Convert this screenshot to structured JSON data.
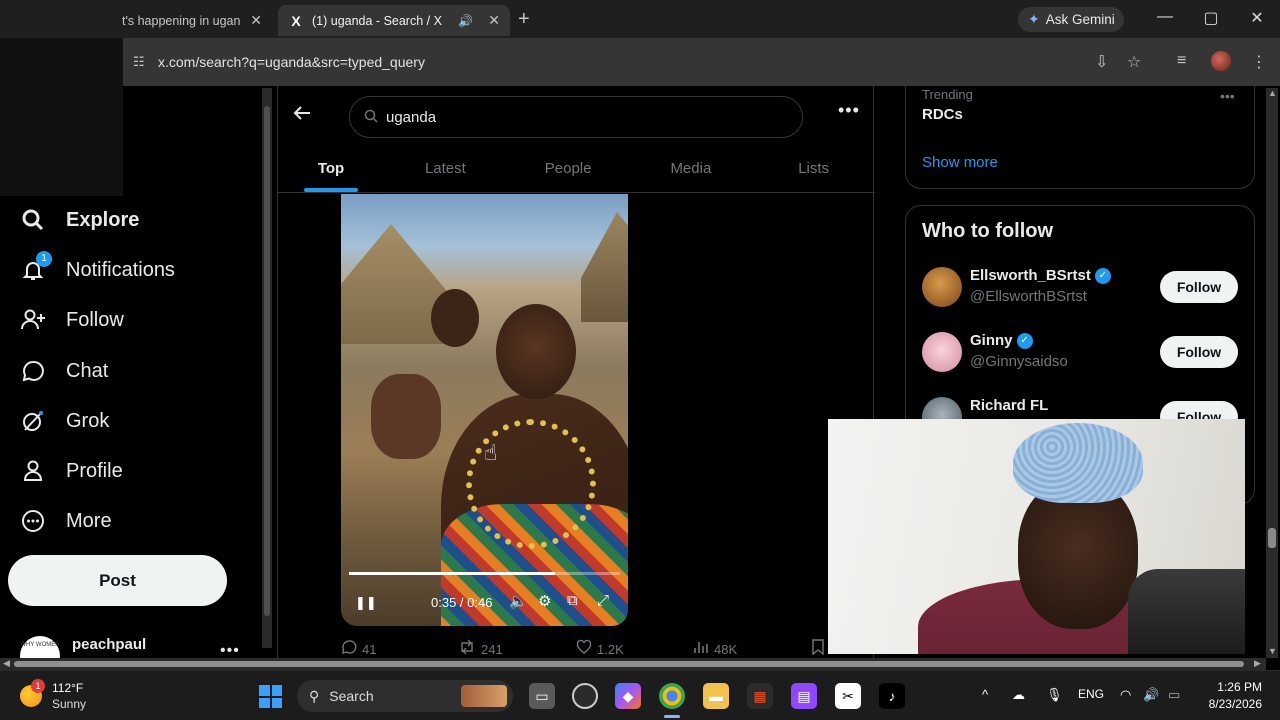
{
  "browser": {
    "tabs": [
      {
        "title": "t's happening in ugan",
        "close": "✕"
      },
      {
        "title": "(1) uganda - Search / X",
        "favicon": "X",
        "close": "✕",
        "speaker": "🔊"
      }
    ],
    "new_tab": "+",
    "gemini_label": "Ask Gemini",
    "window_controls": {
      "minimize": "—",
      "maximize": "▢",
      "close": "✕"
    },
    "url": "x.com/search?q=uganda&src=typed_query"
  },
  "sidebar": {
    "items": [
      {
        "label": "Explore",
        "icon": "search-icon",
        "bold": true
      },
      {
        "label": "Notifications",
        "icon": "bell-icon",
        "badge": "1"
      },
      {
        "label": "Follow",
        "icon": "follow-icon"
      },
      {
        "label": "Chat",
        "icon": "chat-icon"
      },
      {
        "label": "Grok",
        "icon": "grok-icon"
      },
      {
        "label": "Profile",
        "icon": "profile-icon"
      },
      {
        "label": "More",
        "icon": "more-icon"
      }
    ],
    "post_label": "Post",
    "user": {
      "name": "peachpaul",
      "avatar_text": "WHY WOMEN"
    }
  },
  "main": {
    "search_value": "uganda",
    "tabs": [
      "Top",
      "Latest",
      "People",
      "Media",
      "Lists"
    ],
    "active_tab": "Top",
    "video": {
      "time": "0:35 / 0:46",
      "progress": 0.76
    },
    "actions": {
      "replies": "41",
      "reposts": "241",
      "likes": "1.2K",
      "views": "48K"
    }
  },
  "right": {
    "trend_meta": "Trending",
    "trend_name": "RDCs",
    "show_more": "Show more",
    "wtf_title": "Who to follow",
    "follow_label": "Follow",
    "people": [
      {
        "name": "Ellsworth_BSrtst",
        "handle": "@EllsworthBSrtst",
        "verified": true,
        "color": "#b9742f"
      },
      {
        "name": "Ginny",
        "handle": "@Ginnysaidso",
        "verified": true,
        "color": "#f2b6c6"
      },
      {
        "name": "Richard FL",
        "handle": "",
        "verified": false,
        "color": "#7a8a96"
      }
    ]
  },
  "taskbar": {
    "weather": {
      "temp": "112°F",
      "desc": "Sunny",
      "badge": "1"
    },
    "search_label": "Search",
    "tray_lang": "ENG",
    "time": "1:26 PM",
    "date": "8/23/2026"
  },
  "colors": {
    "accent": "#1d9bf0",
    "background": "#000000",
    "text": "#e7e9ea",
    "muted": "#71767b"
  }
}
